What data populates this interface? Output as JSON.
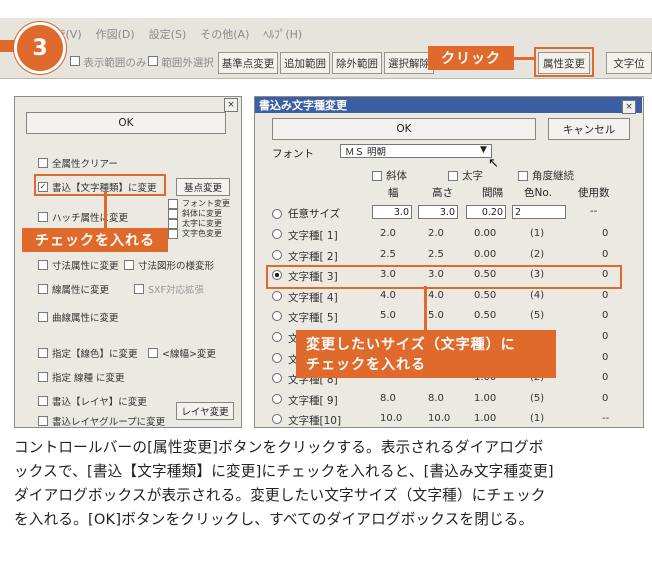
{
  "step": {
    "number": "3"
  },
  "toolbar": {
    "menus": [
      "ﾃ(V)",
      "作図(D)",
      "設定(S)",
      "その他(A)",
      "ﾍﾙﾌﾟ(H)"
    ],
    "checks": [
      "表示範囲のみ",
      "範囲外選択"
    ],
    "buttons": [
      "基準点変更",
      "追加範囲",
      "除外範囲",
      "選択解除",
      "属性変更",
      "文字位"
    ],
    "callout": "クリック"
  },
  "left_dialog": {
    "ok_label": "OK",
    "items": [
      {
        "label": "全属性クリアー",
        "checked": false
      },
      {
        "label": "書込【文字種類】に変更",
        "checked": true
      },
      {
        "label": "ハッチ属性に変更",
        "checked": false
      },
      {
        "label": "寸法属性に変更",
        "checked": false
      },
      {
        "label": "線属性に変更",
        "checked": false
      },
      {
        "label": "曲線属性に変更",
        "checked": false
      },
      {
        "label": "指定【線色】に変更",
        "checked": false
      },
      {
        "label": "指定 線種 に変更",
        "checked": false
      },
      {
        "label": "書込【レイヤ】に変更",
        "checked": false
      },
      {
        "label": "書込レイヤグループに変更",
        "checked": false
      }
    ],
    "side_button": "基点変更",
    "side_checks": [
      "フォント変更",
      "斜体に変更",
      "太字に変更",
      "文字色変更"
    ],
    "dim_check": "寸法図形の様変形",
    "extra_check": "SXF対応拡張",
    "wide_check": "<線幅>変更",
    "layer_button": "レイヤ変更",
    "callout": "チェックを入れる"
  },
  "right_dialog": {
    "title": "書込み文字種変更",
    "ok_label": "OK",
    "cancel_label": "キャンセル",
    "font_label": "フォント",
    "font_value": "ＭＳ 明朝",
    "italic_label": "斜体",
    "bold_label": "太字",
    "angle_label": "角度継続",
    "headers": [
      "幅",
      "高さ",
      "間隔",
      "色No.",
      "使用数"
    ],
    "free_row": {
      "label": "任意サイズ",
      "w": "3.0",
      "h": "3.0",
      "gap": "0.20",
      "color": "2",
      "count": "--"
    },
    "rows": [
      {
        "label": "文字種[ 1]",
        "w": "2.0",
        "h": "2.0",
        "gap": "0.00",
        "color": "(1)",
        "count": "0"
      },
      {
        "label": "文字種[ 2]",
        "w": "2.5",
        "h": "2.5",
        "gap": "0.00",
        "color": "(2)",
        "count": "0"
      },
      {
        "label": "文字種[ 3]",
        "w": "3.0",
        "h": "3.0",
        "gap": "0.50",
        "color": "(3)",
        "count": "0"
      },
      {
        "label": "文字種[ 4]",
        "w": "4.0",
        "h": "4.0",
        "gap": "0.50",
        "color": "(4)",
        "count": "0"
      },
      {
        "label": "文字種[ 5]",
        "w": "5.0",
        "h": "5.0",
        "gap": "0.50",
        "color": "(5)",
        "count": "0"
      },
      {
        "label": "文字種[ 6]",
        "w": "",
        "h": "",
        "gap": "",
        "color": "",
        "count": "0"
      },
      {
        "label": "文字種[ 7]",
        "w": "",
        "h": "",
        "gap": "",
        "color": "",
        "count": "0"
      },
      {
        "label": "文字種[ 8]",
        "w": "",
        "h": "",
        "gap": "1.00",
        "color": "(2)",
        "count": "0"
      },
      {
        "label": "文字種[ 9]",
        "w": "8.0",
        "h": "8.0",
        "gap": "1.00",
        "color": "(5)",
        "count": "0"
      },
      {
        "label": "文字種[10]",
        "w": "10.0",
        "h": "10.0",
        "gap": "1.00",
        "color": "(1)",
        "count": "--"
      }
    ],
    "selected_index": 2,
    "callout_line1": "変更したいサイズ（文字種）に",
    "callout_line2": "チェックを入れる"
  },
  "caption": [
    "コントロールバーの[属性変更]ボタンをクリックする。表示されるダイアログボ",
    "ックスで、[書込【文字種類】に変更]にチェックを入れると、[書込み文字種変更]",
    "ダイアログボックスが表示される。変更したい文字サイズ（文字種）にチェック",
    "を入れる。[OK]ボタンをクリックし、すべてのダイアログボックスを閉じる。"
  ],
  "colors": {
    "accent": "#e06a2c",
    "titlebar": "#3c5fa3",
    "dialog_bg": "#ece9e3"
  }
}
